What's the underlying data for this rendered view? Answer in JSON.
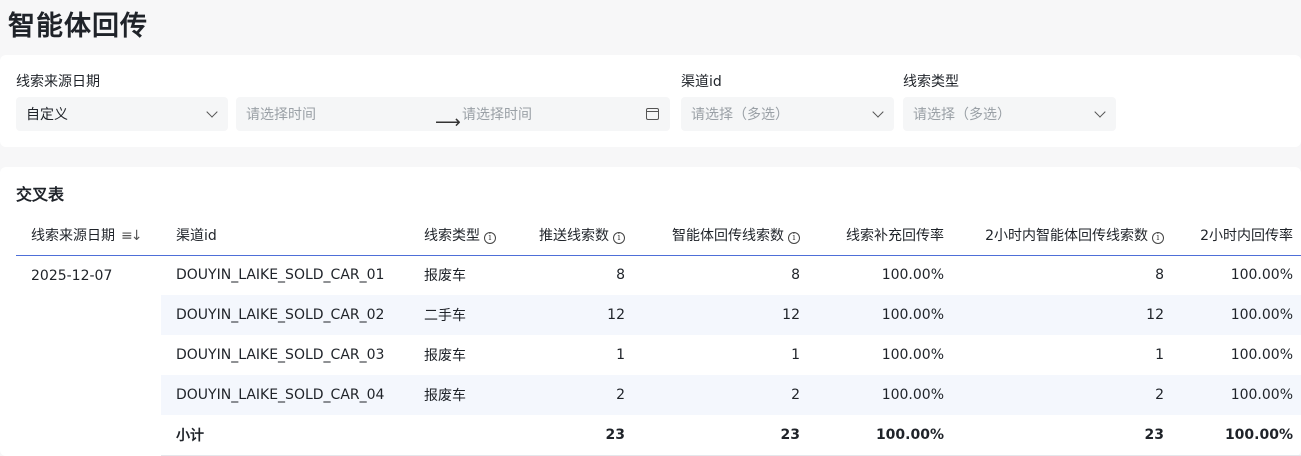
{
  "page": {
    "title": "智能体回传"
  },
  "filters": {
    "date": {
      "label": "线索来源日期",
      "mode_value": "自定义",
      "start_placeholder": "请选择时间",
      "end_placeholder": "请选择时间"
    },
    "channel": {
      "label": "渠道id",
      "placeholder": "请选择（多选）"
    },
    "lead_type": {
      "label": "线索类型",
      "placeholder": "请选择（多选）"
    }
  },
  "table": {
    "title": "交叉表",
    "headers": [
      "线索来源日期",
      "渠道id",
      "线索类型",
      "推送线索数",
      "智能体回传线索数",
      "线索补充回传率",
      "2小时内智能体回传线索数",
      "2小时内回传率"
    ],
    "date": "2025-12-07",
    "rows": [
      {
        "channel": "DOUYIN_LAIKE_SOLD_CAR_01",
        "type": "报废车",
        "pushed": "8",
        "returned": "8",
        "rate": "100.00%",
        "returned_2h": "8",
        "rate_2h": "100.00%"
      },
      {
        "channel": "DOUYIN_LAIKE_SOLD_CAR_02",
        "type": "二手车",
        "pushed": "12",
        "returned": "12",
        "rate": "100.00%",
        "returned_2h": "12",
        "rate_2h": "100.00%"
      },
      {
        "channel": "DOUYIN_LAIKE_SOLD_CAR_03",
        "type": "报废车",
        "pushed": "1",
        "returned": "1",
        "rate": "100.00%",
        "returned_2h": "1",
        "rate_2h": "100.00%"
      },
      {
        "channel": "DOUYIN_LAIKE_SOLD_CAR_04",
        "type": "报废车",
        "pushed": "2",
        "returned": "2",
        "rate": "100.00%",
        "returned_2h": "2",
        "rate_2h": "100.00%"
      }
    ],
    "subtotal": {
      "label": "小计",
      "pushed": "23",
      "returned": "23",
      "rate": "100.00%",
      "returned_2h": "23",
      "rate_2h": "100.00%"
    }
  },
  "icons": {
    "dropdown": "chevron-down-icon",
    "range_arrow": "arrow-right-icon",
    "calendar": "calendar-icon",
    "info": "info-icon",
    "sort": "sort-icon"
  },
  "colors": {
    "header_border": "#4e6fd8",
    "row_stripe": "#f4f7fd",
    "input_bg": "#f5f6f7"
  }
}
